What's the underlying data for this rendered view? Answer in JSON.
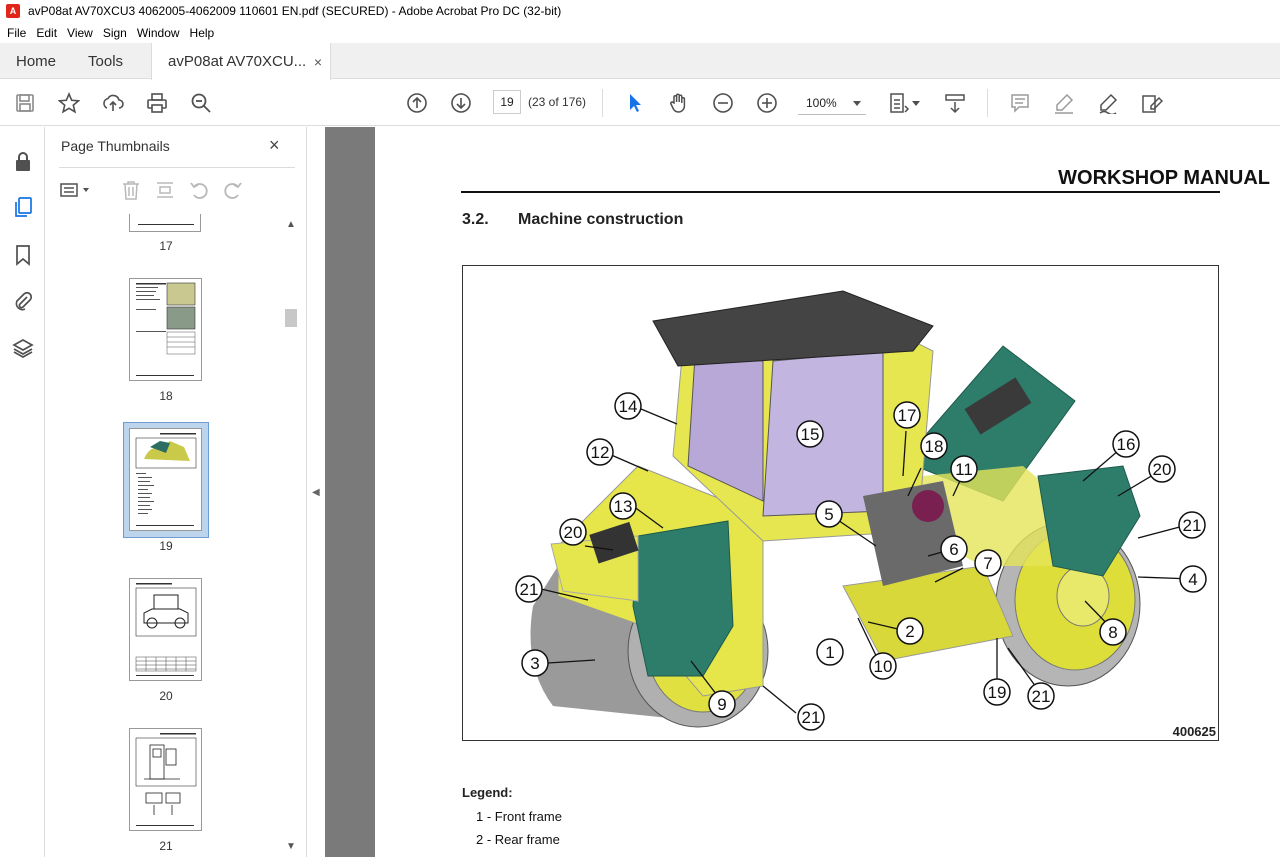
{
  "window": {
    "title": "avP08at AV70XCU3 4062005-4062009 110601 EN.pdf (SECURED) - Adobe Acrobat Pro DC (32-bit)"
  },
  "menu": [
    "File",
    "Edit",
    "View",
    "Sign",
    "Window",
    "Help"
  ],
  "tabs": {
    "home": "Home",
    "tools": "Tools",
    "doc": "avP08at AV70XCU...",
    "close": "×"
  },
  "toolbar": {
    "page_number": "19",
    "page_count": "(23 of 176)",
    "zoom": "100%",
    "icons": [
      "save-icon",
      "bookmark-star-icon",
      "upload-icon",
      "print-icon",
      "find-icon",
      "prev-page-icon",
      "next-page-icon",
      "select-cursor-icon",
      "hand-icon",
      "zoom-out-icon",
      "zoom-in-icon",
      "zoom-dropdown",
      "fit-page-icon",
      "scroll-mode-icon",
      "comment-icon",
      "highlight-icon",
      "sign-icon",
      "fill-sign-icon"
    ]
  },
  "thumbnail_panel": {
    "title": "Page Thumbnails",
    "close": "×",
    "pages": [
      {
        "label": "17"
      },
      {
        "label": "18"
      },
      {
        "label": "19",
        "selected": true
      },
      {
        "label": "20"
      },
      {
        "label": "21"
      }
    ]
  },
  "document": {
    "header": "WORKSHOP MANUAL",
    "section_number": "3.2.",
    "section_title": "Machine construction",
    "figure_id": "400625",
    "callouts": [
      "1",
      "2",
      "3",
      "4",
      "5",
      "6",
      "7",
      "8",
      "9",
      "10",
      "11",
      "12",
      "13",
      "14",
      "15",
      "16",
      "17",
      "18",
      "19",
      "20",
      "20",
      "21",
      "21",
      "21",
      "21",
      "21"
    ],
    "legend_title": "Legend:",
    "legend": [
      "1 - Front frame",
      "2 - Rear frame"
    ]
  },
  "colors": {
    "machine_yellow": "#e8e84a",
    "machine_green": "#2e7d6b",
    "drum_grey": "#a8a8a8",
    "acrobat_red": "#e1251b",
    "selection_blue": "#bcd4ec"
  }
}
